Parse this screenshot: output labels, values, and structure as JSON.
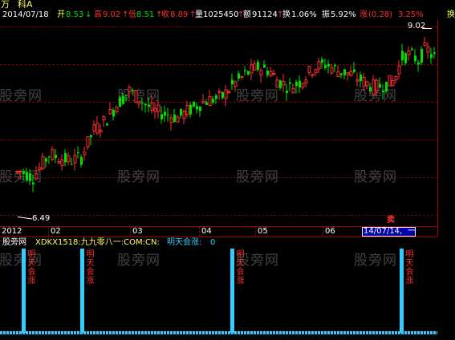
{
  "header": {
    "title": "万",
    "stock_name": "科A",
    "date": "2014/07/18",
    "open_label": "开",
    "open_value": "8.53",
    "open_arrow": "↓",
    "high_label": "高",
    "high_value": "9.02",
    "high_arrow": "↑",
    "low_label": "低",
    "low_value": "8.51",
    "low_arrow": "↑",
    "close_label": "收",
    "close_value": "8.89",
    "close_arrow": "↑",
    "volume_label": "量",
    "volume_value": "1025450",
    "volume_arrow": "↑",
    "amount_label": "额",
    "amount_value": "91124",
    "amount_arrow": "↑",
    "turnover_label": "换",
    "turnover_value": "1.06%",
    "amplitude_label": "振",
    "amplitude_value": "5.92%",
    "change_label": "涨",
    "change_value": "(0.28)",
    "change_pct": "3.25%",
    "trailing_char": "换"
  },
  "price_labels": {
    "high": "9.02",
    "low": "6.49"
  },
  "timeline": {
    "labels": [
      "2012",
      "02",
      "03",
      "04",
      "05",
      "06"
    ],
    "cursor_date": "14/07/14,",
    "cursor_tail": "一",
    "sell_marker": "卖"
  },
  "indicator": {
    "name": "股旁网",
    "formula": "XDKX1518:九九零八一:COM:CN:",
    "signal_label": "明天会涨:",
    "signal_value": "0",
    "signal_vertical_text": "明天会涨"
  },
  "watermark": "股旁网",
  "colors": {
    "up": "#ff3030",
    "down": "#00e000",
    "signal": "#33ccff",
    "grid": "#7a0000",
    "axis": "#a00000"
  },
  "chart_data": {
    "type": "candlestick",
    "symbol": "科A",
    "period": "2012-01 to 2014-07",
    "ylim": [
      6.2,
      9.2
    ],
    "high_marker": 9.02,
    "low_marker": 6.49,
    "indicator_signal_count": 4
  }
}
